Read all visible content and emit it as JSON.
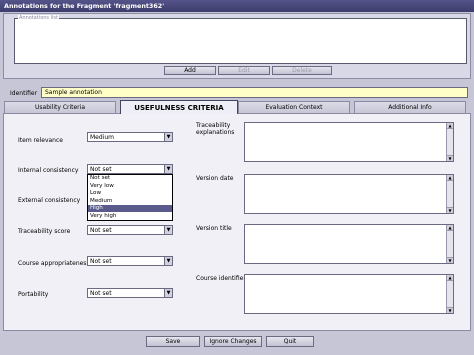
{
  "window": {
    "title": "Annotations for the  Fragment 'fragment362'"
  },
  "annotations": {
    "legend": "Annotations list",
    "add_label": "Add",
    "edit_label": "Edit",
    "delete_label": "Delete"
  },
  "identifier": {
    "label": "Identifier",
    "value": "Sample annotation"
  },
  "tabs": [
    {
      "label": "Usability Criteria"
    },
    {
      "label": "USEFULNESS CRITERIA",
      "active": true
    },
    {
      "label": "Evaluation Context"
    },
    {
      "label": "Additional Info"
    }
  ],
  "fields": {
    "item_relevance": {
      "label": "Item relevance",
      "value": "Medium"
    },
    "internal_consistency": {
      "label": "Internal consistency",
      "value": "Not set"
    },
    "external_consistency": {
      "label": "External consistency"
    },
    "traceability_score": {
      "label": "Traceability score",
      "value": "Not set"
    },
    "course_appropriateness": {
      "label": "Course appropriateness",
      "value": "Not set"
    },
    "portability": {
      "label": "Portability",
      "value": "Not set"
    }
  },
  "dropdown": {
    "options": [
      "Not set",
      "Very low",
      "Low",
      "Medium",
      "High",
      "Very high"
    ],
    "selected": "High"
  },
  "right_fields": {
    "traceability_explanations_line1": "Traceability",
    "traceability_explanations_line2": "explanations",
    "version_date": "Version date",
    "version_title": "Version title",
    "course_identifier": "Course identifier"
  },
  "footer": {
    "save_label": "Save",
    "ignore_label": "Ignore Changes",
    "quit_label": "Quit"
  },
  "colors": {
    "titlebar": "#3c3c6c",
    "identifier_bg": "#ffffc8",
    "selected_option": "#5a5a8c"
  }
}
